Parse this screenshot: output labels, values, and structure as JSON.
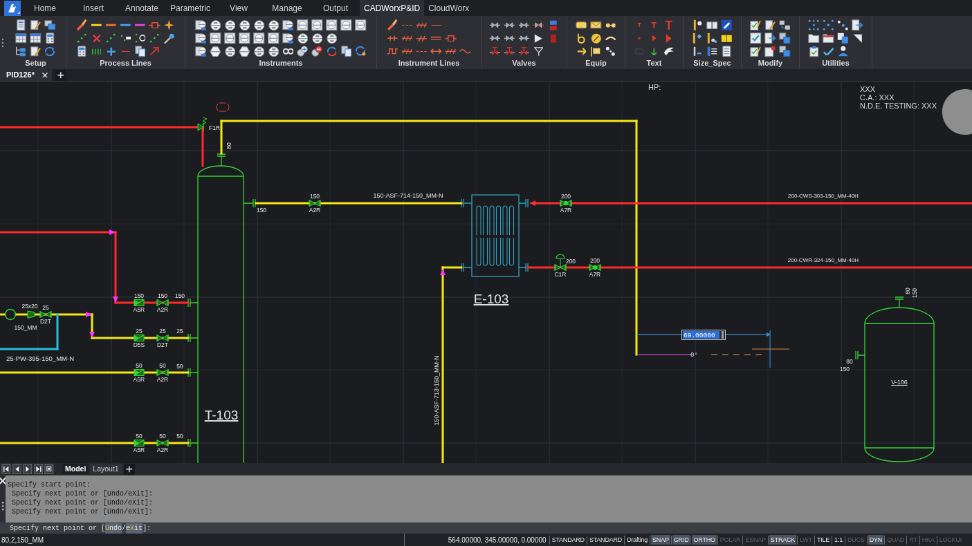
{
  "ribbon_tabs": [
    {
      "label": "Home",
      "selected": false
    },
    {
      "label": "Insert",
      "selected": false
    },
    {
      "label": "Annotate",
      "selected": false
    },
    {
      "label": "Parametric",
      "selected": false
    },
    {
      "label": "View",
      "selected": false
    },
    {
      "label": "Manage",
      "selected": false
    },
    {
      "label": "Output",
      "selected": false
    },
    {
      "label": "CADWorxP&ID",
      "selected": true
    },
    {
      "label": "CloudWorx",
      "selected": false
    }
  ],
  "ribbon_panels": [
    {
      "label": "Setup"
    },
    {
      "label": "Process Lines"
    },
    {
      "label": "Instruments"
    },
    {
      "label": "Instrument Lines"
    },
    {
      "label": "Valves"
    },
    {
      "label": "Equip"
    },
    {
      "label": "Text"
    },
    {
      "label": "Size_Spec"
    },
    {
      "label": "Modify"
    },
    {
      "label": "Utilities"
    }
  ],
  "document_tabs": [
    {
      "label": "PID126*",
      "selected": true
    }
  ],
  "drawing": {
    "notes": [
      {
        "text": "HP:"
      },
      {
        "text": "XXX"
      },
      {
        "text": "C.A.: XXX"
      },
      {
        "text": "N.D.E. TESTING: XXX"
      }
    ],
    "equipment": [
      {
        "kind": "column",
        "tag": "T-103"
      },
      {
        "kind": "exchanger",
        "tag": "E-103"
      },
      {
        "kind": "vessel",
        "tag": "V-106"
      }
    ],
    "pipes": [
      {
        "color": "#ff2a2a"
      },
      {
        "color": "#f5ea14"
      },
      {
        "color": "#f5ea14",
        "label": "150-ASF-714-150_MM-N"
      },
      {
        "color": "#ff2a2a",
        "label": "200-CWS-303-150_MM-40H"
      },
      {
        "color": "#ff2a2a",
        "label": "200-CWR-324-150_MM-40H"
      },
      {
        "color": "#f5ea14",
        "label": "150-ASF-713-150_MM-N"
      },
      {
        "color": "#ff2a2a"
      },
      {
        "color": "#f5ea14"
      },
      {
        "color": "#22c0e0",
        "label": "25-PW-395-150_MM-N"
      },
      {
        "color": "#f5ea14"
      },
      {
        "color": "#f5ea14"
      }
    ],
    "valves": [
      {
        "kind": "relief",
        "tag": "F1R"
      },
      {
        "kind": "gate",
        "size": "150",
        "tag": "A2R"
      },
      {
        "kind": "ball",
        "size": "200",
        "tag": "A7R"
      },
      {
        "kind": "control",
        "size": "200",
        "tag": "C1R"
      },
      {
        "kind": "ball",
        "size": "200",
        "tag": "A7R"
      },
      {
        "kind": "check",
        "size": "150",
        "tag": "A5R"
      },
      {
        "kind": "gate",
        "size": "150",
        "tag": "A2R"
      },
      {
        "kind": "gate",
        "size": "25",
        "tag": "D2T"
      },
      {
        "kind": "check",
        "size": "25",
        "tag": "D5S"
      },
      {
        "kind": "gate",
        "size": "25",
        "tag": "D2T"
      },
      {
        "kind": "check",
        "size": "50",
        "tag": "A5R"
      },
      {
        "kind": "gate",
        "size": "50",
        "tag": "A2R"
      },
      {
        "kind": "check",
        "size": "50",
        "tag": "A5R"
      },
      {
        "kind": "gate",
        "size": "50",
        "tag": "A2R"
      }
    ],
    "size_labels": [
      "80",
      "150",
      "150",
      "25",
      "50",
      "50",
      "80",
      "150",
      "80",
      "150",
      "25x20",
      "150_MM"
    ],
    "dimension": {
      "value": "69.00000",
      "angle": "0°"
    }
  },
  "layout_tabs": [
    {
      "label": "Model",
      "selected": true
    },
    {
      "label": "Layout1",
      "selected": false
    }
  ],
  "command_history": [
    "Specify start point:",
    " Specify next point or [Undo/eXit]:",
    " Specify next point or [Undo/eXit]:",
    " Specify next point or [Undo/eXit]:"
  ],
  "command_line": [
    {
      "kind": "text",
      "text": "Specify next point or ["
    },
    {
      "kind": "option",
      "key": "U",
      "rest": "ndo"
    },
    {
      "kind": "text",
      "text": "/"
    },
    {
      "kind": "option",
      "lead": "e",
      "key": "X",
      "rest": "it"
    },
    {
      "kind": "text",
      "text": "]:"
    }
  ],
  "status_bar": {
    "readout": "80,2,150_MM",
    "coordinates": "564.00000, 345.00000, 0.00000",
    "items": [
      {
        "label": "STANDARD",
        "kind": "text"
      },
      {
        "label": "STANDARD",
        "kind": "text"
      },
      {
        "label": "Drafting",
        "kind": "text"
      },
      {
        "label": "SNAP",
        "kind": "toggle",
        "on": true
      },
      {
        "label": "GRID",
        "kind": "toggle",
        "on": true
      },
      {
        "label": "ORTHO",
        "kind": "toggle",
        "on": true
      },
      {
        "label": "POLAR",
        "kind": "toggle",
        "on": false
      },
      {
        "label": "ESNAP",
        "kind": "toggle",
        "on": false
      },
      {
        "label": "STRACK",
        "kind": "toggle",
        "on": true
      },
      {
        "label": "LWT",
        "kind": "toggle",
        "on": false
      },
      {
        "label": "TILE",
        "kind": "text"
      },
      {
        "label": "1:1",
        "kind": "text"
      },
      {
        "label": "DUCS",
        "kind": "toggle",
        "on": false
      },
      {
        "label": "DYN",
        "kind": "toggle",
        "on": true
      },
      {
        "label": "QUAD",
        "kind": "toggle",
        "on": false
      },
      {
        "label": "RT",
        "kind": "toggle",
        "on": false
      },
      {
        "label": "HKA",
        "kind": "toggle",
        "on": false
      },
      {
        "label": "LOCKUI",
        "kind": "toggle",
        "on": false
      }
    ]
  }
}
